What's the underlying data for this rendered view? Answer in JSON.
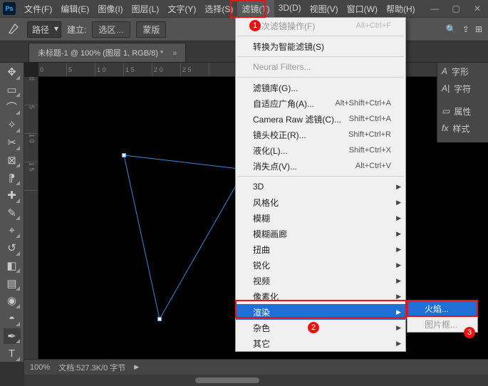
{
  "app_badge": "Ps",
  "menubar": [
    "文件(F)",
    "编辑(E)",
    "图像(I)",
    "图层(L)",
    "文字(Y)",
    "选择(S)",
    "滤镜(T)",
    "3D(D)",
    "视图(V)",
    "窗口(W)",
    "帮助(H)"
  ],
  "open_menu_index": 6,
  "optionbar": {
    "path_label": "路径",
    "build_label": "建立:",
    "btn1": "选区…",
    "btn2": "蒙版"
  },
  "document_tab": "未标题-1 @ 100% (图层 1, RGB/8) *",
  "ruler_top": [
    "0",
    "5",
    "1 0",
    "1 5",
    "2 0",
    "2 5"
  ],
  "ruler_left": [
    "0",
    "5",
    "1 0",
    "1 5"
  ],
  "right_panels": [
    {
      "icon": "A",
      "label": "字形"
    },
    {
      "icon": "A|",
      "label": "字符"
    },
    {
      "icon": "▭",
      "label": "属性"
    },
    {
      "icon": "fx",
      "label": "样式"
    }
  ],
  "status": {
    "zoom": "100%",
    "docinfo": "文档:527.3K/0 字节"
  },
  "filter_menu": [
    {
      "label": "上次滤镜操作(F)",
      "shortcut": "Alt+Ctrl+F",
      "disabled": true,
      "kind": "item"
    },
    {
      "kind": "sep"
    },
    {
      "label": "转换为智能滤镜(S)",
      "kind": "item"
    },
    {
      "kind": "sep"
    },
    {
      "label": "Neural Filters...",
      "disabled": true,
      "kind": "item"
    },
    {
      "kind": "sep"
    },
    {
      "label": "滤镜库(G)...",
      "kind": "item"
    },
    {
      "label": "自适应广角(A)...",
      "shortcut": "Alt+Shift+Ctrl+A",
      "kind": "item"
    },
    {
      "label": "Camera Raw 滤镜(C)...",
      "shortcut": "Shift+Ctrl+A",
      "kind": "item"
    },
    {
      "label": "镜头校正(R)...",
      "shortcut": "Shift+Ctrl+R",
      "kind": "item"
    },
    {
      "label": "液化(L)...",
      "shortcut": "Shift+Ctrl+X",
      "kind": "item"
    },
    {
      "label": "消失点(V)...",
      "shortcut": "Alt+Ctrl+V",
      "kind": "item"
    },
    {
      "kind": "sep"
    },
    {
      "label": "3D",
      "sub": true,
      "kind": "item"
    },
    {
      "label": "风格化",
      "sub": true,
      "kind": "item"
    },
    {
      "label": "模糊",
      "sub": true,
      "kind": "item"
    },
    {
      "label": "模糊画廊",
      "sub": true,
      "kind": "item"
    },
    {
      "label": "扭曲",
      "sub": true,
      "kind": "item"
    },
    {
      "label": "锐化",
      "sub": true,
      "kind": "item"
    },
    {
      "label": "视频",
      "sub": true,
      "kind": "item"
    },
    {
      "label": "像素化",
      "sub": true,
      "kind": "item"
    },
    {
      "label": "渲染",
      "sub": true,
      "hl": true,
      "kind": "item"
    },
    {
      "label": "杂色",
      "sub": true,
      "kind": "item"
    },
    {
      "label": "其它",
      "sub": true,
      "kind": "item"
    }
  ],
  "submenu": [
    {
      "label": "火焰...",
      "hl": true
    },
    {
      "label": "图片框...",
      "disabled": true
    }
  ],
  "annotations": {
    "a1": "1",
    "a2": "2",
    "a3": "3"
  }
}
